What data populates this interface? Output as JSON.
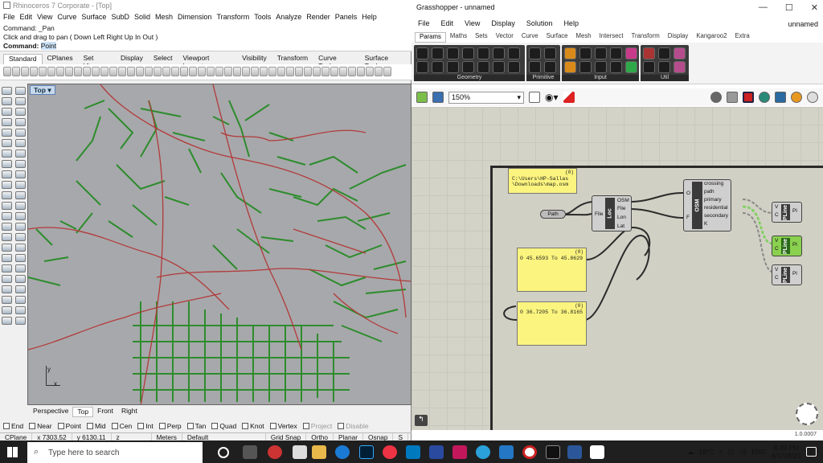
{
  "rhino": {
    "title": "Rhinoceros 7 Corporate - [Top]",
    "menu": [
      "File",
      "Edit",
      "View",
      "Curve",
      "Surface",
      "SubD",
      "Solid",
      "Mesh",
      "Dimension",
      "Transform",
      "Tools",
      "Analyze",
      "Render",
      "Panels",
      "Help"
    ],
    "cmd_lines": [
      "Command: _Pan",
      "Click and drag to pan ( Down  Left  Right  Up  In  Out )"
    ],
    "cmd_prompt": "Command:",
    "cmd_value": "Point",
    "tabs": [
      "Standard",
      "CPlanes",
      "Set View",
      "Display",
      "Select",
      "Viewport Layout",
      "Visibility",
      "Transform",
      "Curve Tools",
      "Surface Tools"
    ],
    "viewport_label": "Top",
    "axis_x": "x",
    "axis_y": "y",
    "view_tabs": [
      "Perspective",
      "Top",
      "Front",
      "Right"
    ],
    "osnaps": [
      "End",
      "Near",
      "Point",
      "Mid",
      "Cen",
      "Int",
      "Perp",
      "Tan",
      "Quad",
      "Knot",
      "Vertex",
      "Project",
      "Disable"
    ],
    "status": {
      "cplane": "CPlane",
      "x": "x 7303.52",
      "y": "y 6130.11",
      "z": "z",
      "units": "Meters",
      "layer": "Default",
      "grid_snap": "Grid Snap",
      "ortho": "Ortho",
      "planar": "Planar",
      "osnap": "Osnap",
      "smart": "S"
    }
  },
  "grasshopper": {
    "title": "Grasshopper - unnamed",
    "menu": [
      "File",
      "Edit",
      "View",
      "Display",
      "Solution",
      "Help"
    ],
    "doc_name": "unnamed",
    "ribbon_tabs": [
      "Params",
      "Maths",
      "Sets",
      "Vector",
      "Curve",
      "Surface",
      "Mesh",
      "Intersect",
      "Transform",
      "Display",
      "Kangaroo2",
      "Extra"
    ],
    "ribbon_groups": [
      "Geometry",
      "Primitive",
      "Input",
      "Util"
    ],
    "zoom": "150%",
    "panel1_hdr": "(0)",
    "panel1_text": "C:\\Users\\HP-Sallas\\Downloads\\map.osm",
    "panel2_hdr": "(0)",
    "panel2_text": "0 45.6593 To 45.8629",
    "panel3_hdr": "(0)",
    "panel3_text": "0 36.7205 To 36.8165",
    "path_label": "Path",
    "loc_comp": {
      "name": "Loc",
      "in": "File",
      "outs": [
        "OSM",
        "File",
        "Lon",
        "Lat"
      ]
    },
    "osm_comp": {
      "name": "OSM",
      "ins": [
        "O",
        "F"
      ],
      "outs": [
        "crossing",
        "path",
        "primary",
        "residential",
        "secondary",
        "K"
      ]
    },
    "pline_comp": {
      "name": "PLine",
      "ins": [
        "V",
        "C"
      ],
      "out": "Pl"
    },
    "version": "1.0.0007"
  },
  "taskbar": {
    "search_placeholder": "Type here to search",
    "weather": "18°C",
    "lang": "ENG",
    "time": "8:39 PM",
    "date": "8/17/2021",
    "notif": "2"
  }
}
